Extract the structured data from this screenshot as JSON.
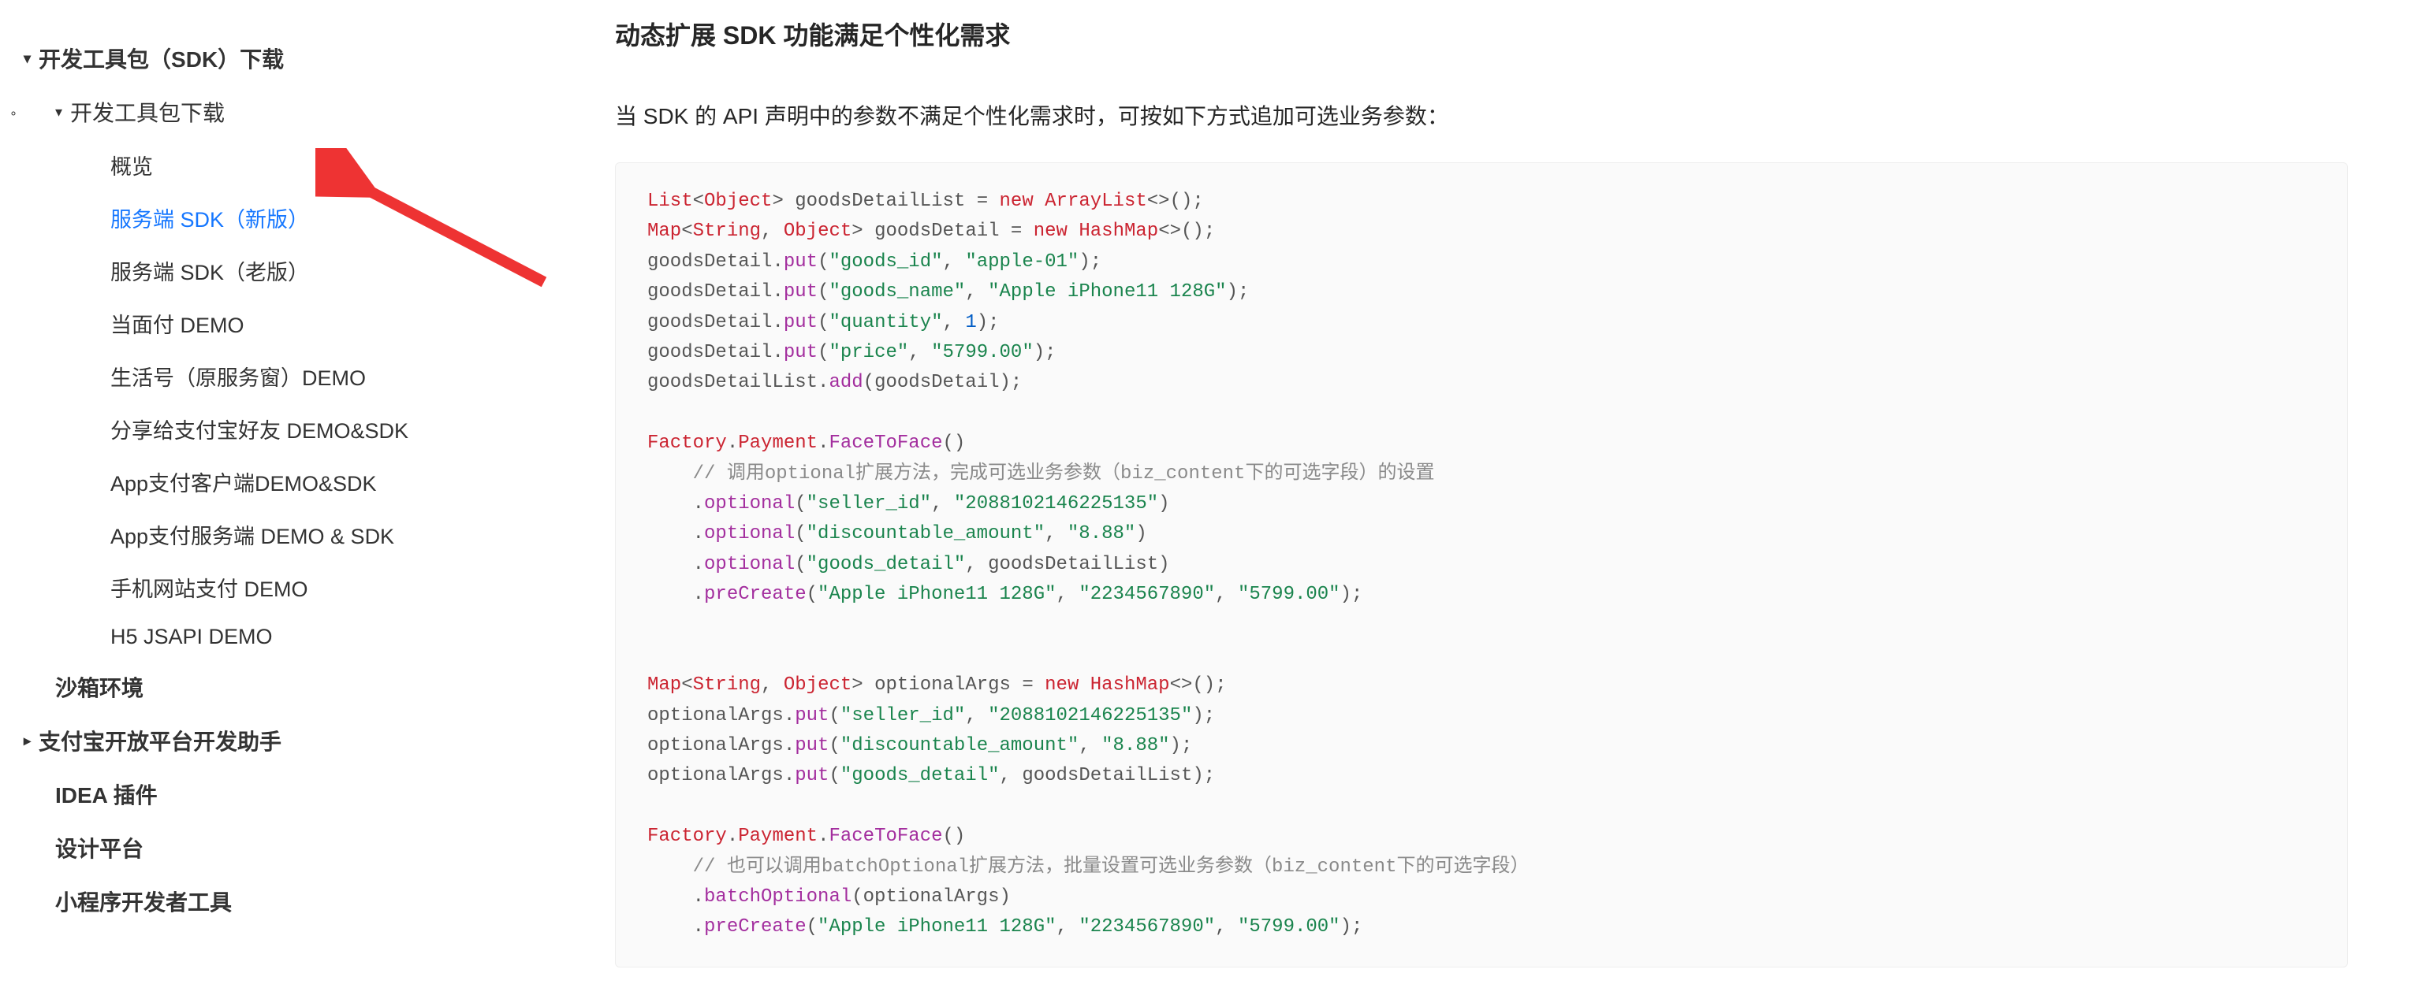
{
  "sidebar": {
    "root": {
      "label": "开发工具包（SDK）下载",
      "sub": {
        "label": "开发工具包下载",
        "items": [
          {
            "label": "概览"
          },
          {
            "label": "服务端 SDK（新版）",
            "active": true
          },
          {
            "label": "服务端 SDK（老版）"
          },
          {
            "label": "当面付 DEMO"
          },
          {
            "label": "生活号（原服务窗）DEMO"
          },
          {
            "label": "分享给支付宝好友 DEMO&SDK"
          },
          {
            "label": "App支付客户端DEMO&SDK"
          },
          {
            "label": "App支付服务端 DEMO & SDK"
          },
          {
            "label": "手机网站支付 DEMO"
          },
          {
            "label": "H5 JSAPI DEMO"
          }
        ]
      }
    },
    "items_after": [
      {
        "label": "沙箱环境",
        "expandable": false
      },
      {
        "label": "支付宝开放平台开发助手",
        "expandable": true
      },
      {
        "label": "IDEA 插件",
        "expandable": false
      },
      {
        "label": "设计平台",
        "expandable": false
      },
      {
        "label": "小程序开发者工具",
        "expandable": false
      }
    ]
  },
  "main": {
    "heading": "动态扩展 SDK 功能满足个性化需求",
    "desc": "当 SDK 的 API 声明中的参数不满足个性化需求时，可按如下方式追加可选业务参数：",
    "code": {
      "line1": {
        "t1": "List",
        "t2": "Object",
        "v": "goodsDetailList",
        "kw": "new",
        "t3": "ArrayList"
      },
      "line2": {
        "t1": "Map",
        "t2": "String",
        "t3": "Object",
        "v": "goodsDetail",
        "kw": "new",
        "t4": "HashMap"
      },
      "line3": {
        "obj": "goodsDetail",
        "fn": "put",
        "a1": "\"goods_id\"",
        "a2": "\"apple-01\""
      },
      "line4": {
        "obj": "goodsDetail",
        "fn": "put",
        "a1": "\"goods_name\"",
        "a2": "\"Apple iPhone11 128G\""
      },
      "line5": {
        "obj": "goodsDetail",
        "fn": "put",
        "a1": "\"quantity\"",
        "a2": "1"
      },
      "line6": {
        "obj": "goodsDetail",
        "fn": "put",
        "a1": "\"price\"",
        "a2": "\"5799.00\""
      },
      "line7": {
        "obj": "goodsDetailList",
        "fn": "add",
        "arg": "goodsDetail"
      },
      "line9": {
        "c1": "Factory",
        "c2": "Payment",
        "c3": "FaceToFace"
      },
      "line10": {
        "cmt": "// 调用optional扩展方法，完成可选业务参数（biz_content下的可选字段）的设置"
      },
      "line11": {
        "fn": "optional",
        "a1": "\"seller_id\"",
        "a2": "\"2088102146225135\""
      },
      "line12": {
        "fn": "optional",
        "a1": "\"discountable_amount\"",
        "a2": "\"8.88\""
      },
      "line13": {
        "fn": "optional",
        "a1": "\"goods_detail\"",
        "a2": "goodsDetailList"
      },
      "line14": {
        "fn": "preCreate",
        "a1": "\"Apple iPhone11 128G\"",
        "a2": "\"2234567890\"",
        "a3": "\"5799.00\""
      },
      "line17": {
        "t1": "Map",
        "t2": "String",
        "t3": "Object",
        "v": "optionalArgs",
        "kw": "new",
        "t4": "HashMap"
      },
      "line18": {
        "obj": "optionalArgs",
        "fn": "put",
        "a1": "\"seller_id\"",
        "a2": "\"2088102146225135\""
      },
      "line19": {
        "obj": "optionalArgs",
        "fn": "put",
        "a1": "\"discountable_amount\"",
        "a2": "\"8.88\""
      },
      "line20": {
        "obj": "optionalArgs",
        "fn": "put",
        "a1": "\"goods_detail\"",
        "a2": "goodsDetailList"
      },
      "line22": {
        "c1": "Factory",
        "c2": "Payment",
        "c3": "FaceToFace"
      },
      "line23": {
        "cmt": "// 也可以调用batchOptional扩展方法，批量设置可选业务参数（biz_content下的可选字段）"
      },
      "line24": {
        "fn": "batchOptional",
        "arg": "optionalArgs"
      },
      "line25": {
        "fn": "preCreate",
        "a1": "\"Apple iPhone11 128G\"",
        "a2": "\"2234567890\"",
        "a3": "\"5799.00\""
      }
    }
  }
}
